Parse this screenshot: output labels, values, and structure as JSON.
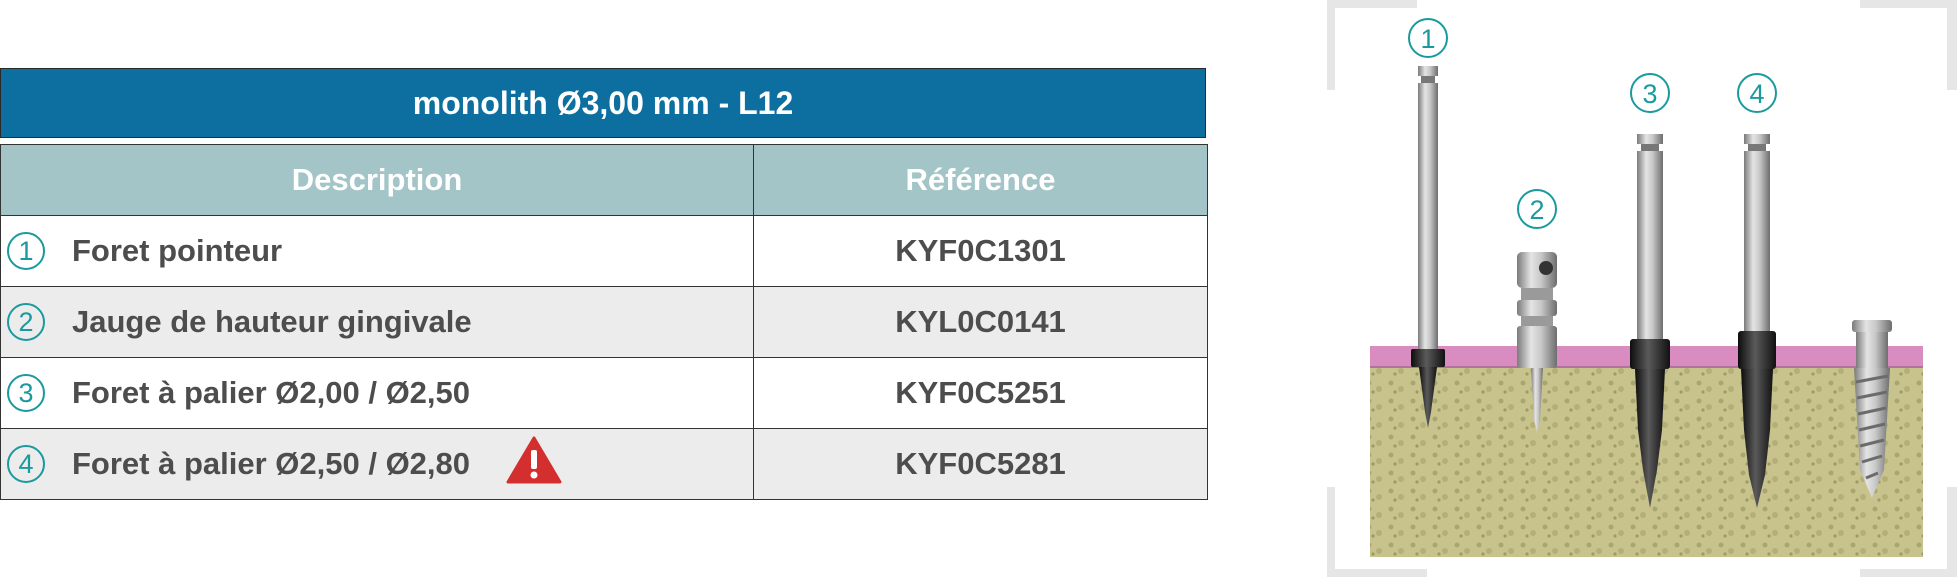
{
  "header": {
    "title": "monolith Ø3,00 mm - L12"
  },
  "table": {
    "columns": [
      "Description",
      "Référence"
    ],
    "rows": [
      {
        "num": "1",
        "description": "Foret pointeur",
        "reference": "KYF0C1301",
        "warning": false
      },
      {
        "num": "2",
        "description": "Jauge de hauteur gingivale",
        "reference": "KYL0C0141",
        "warning": false
      },
      {
        "num": "3",
        "description": "Foret à palier Ø2,00 / Ø2,50",
        "reference": "KYF0C5251",
        "warning": false
      },
      {
        "num": "4",
        "description": "Foret à palier Ø2,50 / Ø2,80",
        "reference": "KYF0C5281",
        "warning": true
      }
    ]
  },
  "illustration": {
    "labels": [
      "1",
      "2",
      "3",
      "4"
    ]
  },
  "colors": {
    "title_bg": "#0d6fa0",
    "header_bg": "#a3c5c8",
    "accent": "#1b9a9e",
    "warning": "#d32f2f",
    "gum": "#d88cc0",
    "bone": "#c9c48e"
  }
}
